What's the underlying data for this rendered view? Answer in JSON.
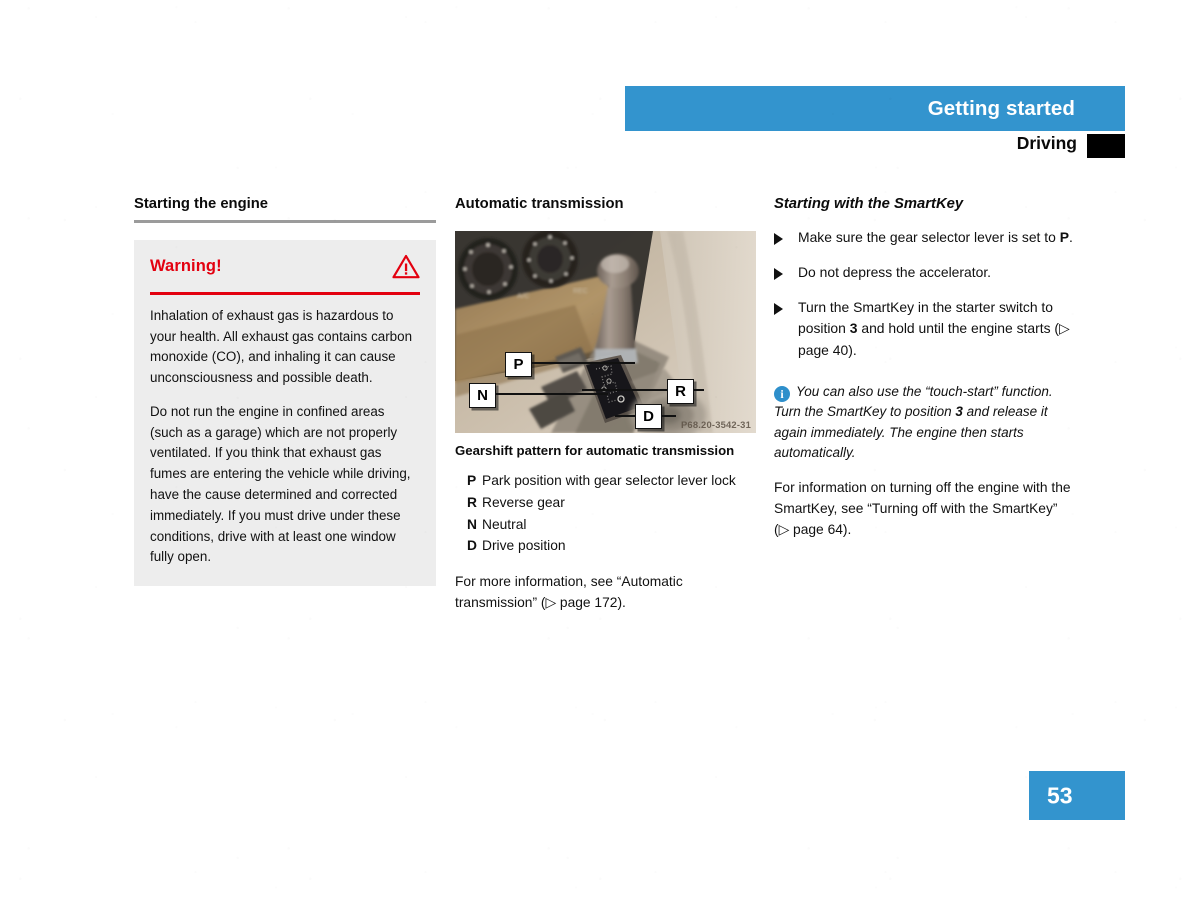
{
  "header": {
    "section_title": "Getting started",
    "chapter_label": "Driving",
    "thumb_index_icon": "black-thumb-index-marker"
  },
  "page_number": "53",
  "colors": {
    "accent_blue": "#3394ce",
    "warning_red": "#e3000f",
    "warning_box_bg": "#ededed",
    "rule_gray": "#9b9b9b",
    "info_blue": "#2e8fcb"
  },
  "left_column": {
    "heading": "Starting the engine",
    "warning": {
      "title": "Warning!",
      "icon": "warning-triangle-icon",
      "paragraphs": [
        "Inhalation of exhaust gas is hazardous to your health. All exhaust gas contains carbon monoxide (CO), and inhaling it can cause unconsciousness and possible death.",
        "Do not run the engine in confined areas (such as a garage) which are not properly ventilated. If you think that exhaust gas fumes are entering the vehicle while driving, have the cause determined and corrected immediately. If you must drive under these conditions, drive with at least one window fully open."
      ]
    }
  },
  "middle_column": {
    "heading": "Automatic transmission",
    "figure": {
      "alt": "Center console with automatic transmission gear selector lever",
      "figure_id": "P68.20-3542-31",
      "callouts": [
        {
          "label": "P"
        },
        {
          "label": "R"
        },
        {
          "label": "N"
        },
        {
          "label": "D"
        }
      ]
    },
    "caption": "Gearshift pattern for automatic transmission",
    "definitions": [
      {
        "term": "P",
        "desc": "Park position with gear selector lever lock"
      },
      {
        "term": "R",
        "desc": "Reverse gear"
      },
      {
        "term": "N",
        "desc": "Neutral"
      },
      {
        "term": "D",
        "desc": "Drive position"
      }
    ],
    "cross_reference": "For more information, see “Automatic transmission” (▷ page 172)."
  },
  "right_column": {
    "heading": "Starting with the SmartKey",
    "steps": [
      {
        "text_before": "Make sure the gear selector lever is set to ",
        "emphasis": "P",
        "text_after": "."
      },
      {
        "text_before": "Do not depress the accelerator.",
        "emphasis": "",
        "text_after": ""
      },
      {
        "text_before": "Turn the SmartKey in the starter switch to position ",
        "emphasis": "3",
        "text_after": " and hold until the engine starts (▷ page 40)."
      }
    ],
    "note": {
      "icon": "info-circle-icon",
      "icon_glyph": "i",
      "text_before": "You can also use the “touch-start” function. Turn the SmartKey to position ",
      "emphasis": "3",
      "text_after": " and release it again immediately. The engine then starts automatically."
    },
    "closing_paragraph": "For information on turning off the engine with the SmartKey, see “Turning off with the SmartKey” (▷ page 64)."
  }
}
